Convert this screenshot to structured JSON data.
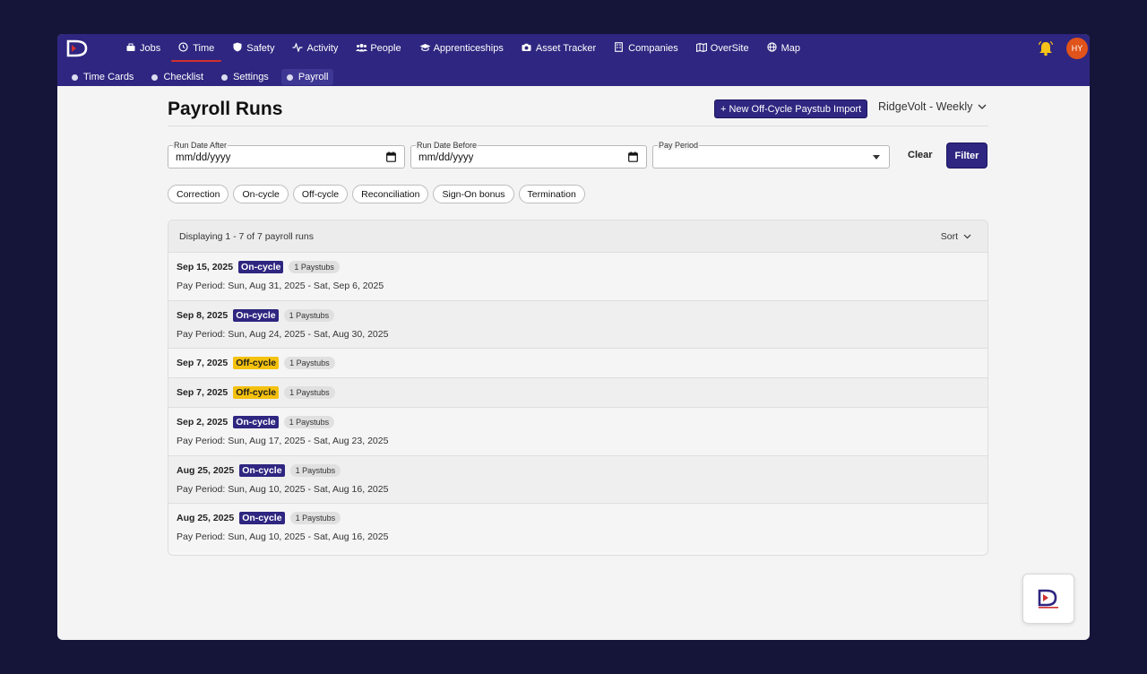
{
  "nav": {
    "items": [
      {
        "label": "Jobs",
        "icon": "briefcase-icon"
      },
      {
        "label": "Time",
        "icon": "clock-icon"
      },
      {
        "label": "Safety",
        "icon": "shield-icon"
      },
      {
        "label": "Activity",
        "icon": "activity-icon"
      },
      {
        "label": "People",
        "icon": "people-icon"
      },
      {
        "label": "Apprenticeships",
        "icon": "graduation-cap-icon"
      },
      {
        "label": "Asset Tracker",
        "icon": "camera-icon"
      },
      {
        "label": "Companies",
        "icon": "building-icon"
      },
      {
        "label": "OverSite",
        "icon": "map-book-icon"
      },
      {
        "label": "Map",
        "icon": "globe-icon"
      }
    ],
    "active": "Time"
  },
  "user": {
    "initials": "HY"
  },
  "subnav": {
    "items": [
      "Time Cards",
      "Checklist",
      "Settings",
      "Payroll"
    ],
    "active": "Payroll"
  },
  "page": {
    "title": "Payroll Runs",
    "new_button": "+ New Off-Cycle Paystub Import",
    "company": "RidgeVolt - Weekly"
  },
  "filters": {
    "run_after": {
      "label": "Run Date After",
      "value": "mm/dd/yyyy"
    },
    "run_before": {
      "label": "Run Date Before",
      "value": "mm/dd/yyyy"
    },
    "pay_period": {
      "label": "Pay Period",
      "value": ""
    },
    "clear": "Clear",
    "filter": "Filter"
  },
  "chips": [
    "Correction",
    "On-cycle",
    "Off-cycle",
    "Reconciliation",
    "Sign-On bonus",
    "Termination"
  ],
  "list": {
    "count_text": "Displaying 1 - 7 of 7 payroll runs",
    "sort_label": "Sort",
    "rows": [
      {
        "date": "Sep 15, 2025",
        "type": "On-cycle",
        "paystubs": "1 Paystubs",
        "period": "Pay Period: Sun, Aug 31, 2025 - Sat, Sep 6, 2025"
      },
      {
        "date": "Sep 8, 2025",
        "type": "On-cycle",
        "paystubs": "1 Paystubs",
        "period": "Pay Period: Sun, Aug 24, 2025 - Sat, Aug 30, 2025"
      },
      {
        "date": "Sep 7, 2025",
        "type": "Off-cycle",
        "paystubs": "1 Paystubs",
        "period": ""
      },
      {
        "date": "Sep 7, 2025",
        "type": "Off-cycle",
        "paystubs": "1 Paystubs",
        "period": ""
      },
      {
        "date": "Sep 2, 2025",
        "type": "On-cycle",
        "paystubs": "1 Paystubs",
        "period": "Pay Period: Sun, Aug 17, 2025 - Sat, Aug 23, 2025"
      },
      {
        "date": "Aug 25, 2025",
        "type": "On-cycle",
        "paystubs": "1 Paystubs",
        "period": "Pay Period: Sun, Aug 10, 2025 - Sat, Aug 16, 2025"
      },
      {
        "date": "Aug 25, 2025",
        "type": "On-cycle",
        "paystubs": "1 Paystubs",
        "period": "Pay Period: Sun, Aug 10, 2025 - Sat, Aug 16, 2025"
      }
    ]
  },
  "colors": {
    "brand": "#2e2680",
    "off_cycle": "#f4c10f",
    "accent_red": "#d03030",
    "avatar": "#e0531a"
  }
}
